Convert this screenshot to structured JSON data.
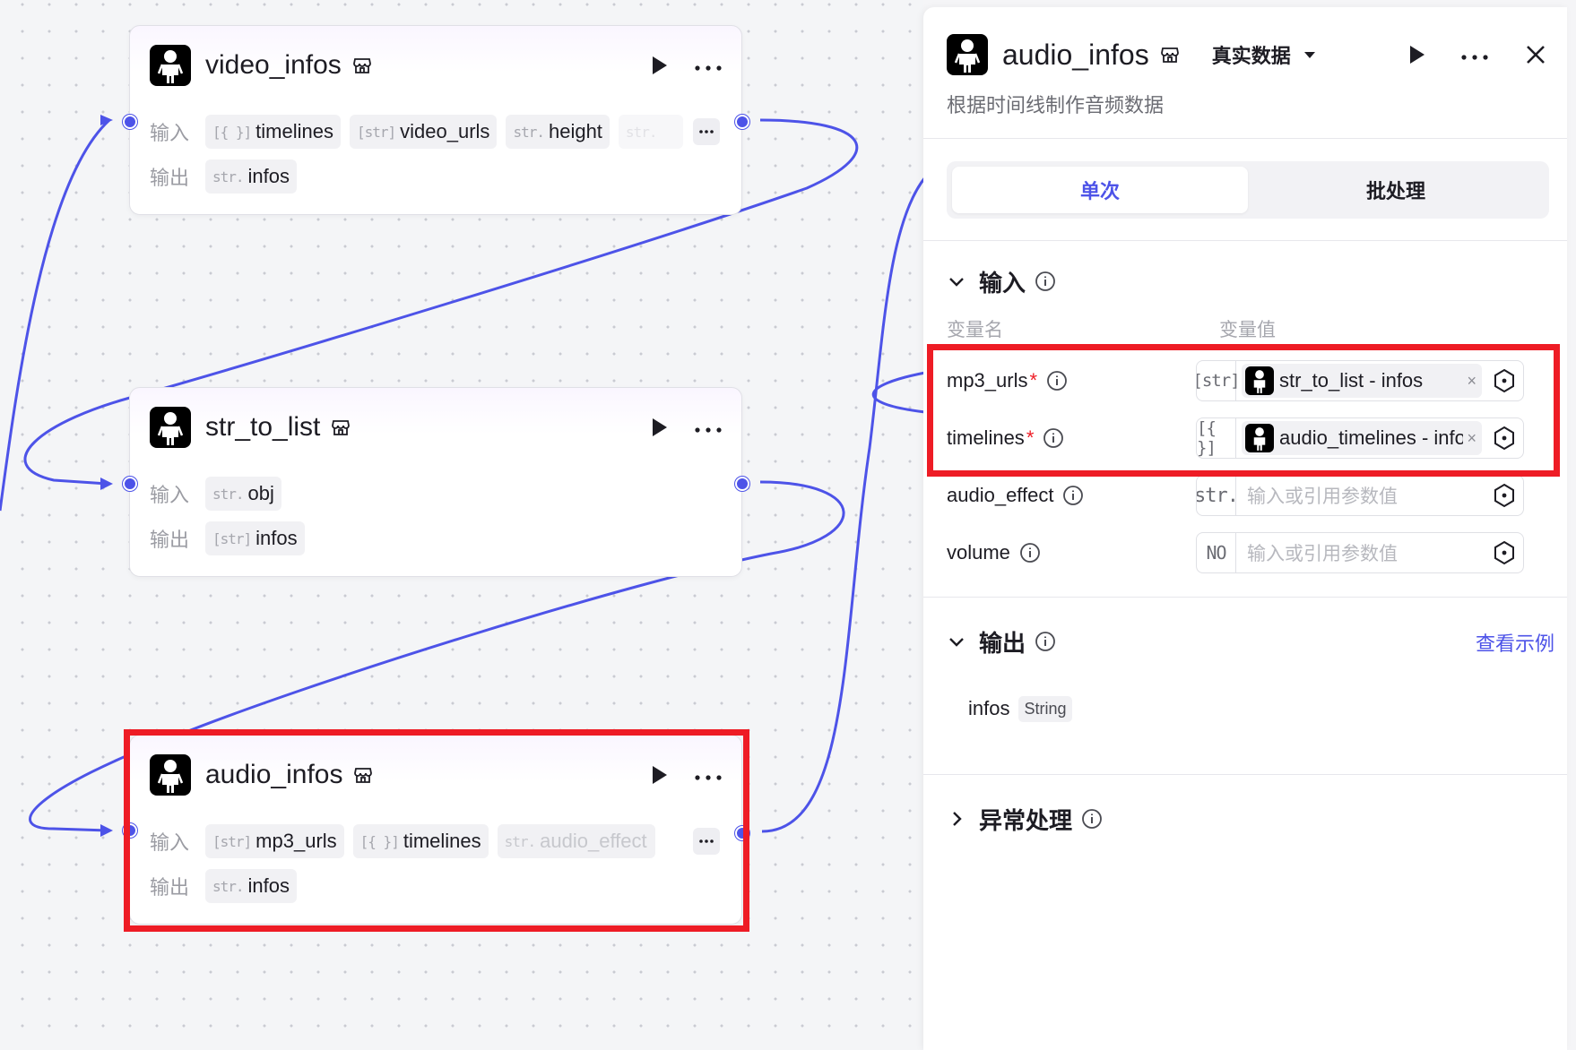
{
  "nodes": {
    "video_infos": {
      "title": "video_infos",
      "input_label": "输入",
      "output_label": "输出",
      "inputs": [
        {
          "type": "[{ }]",
          "name": "timelines"
        },
        {
          "type": "[str]",
          "name": "video_urls"
        },
        {
          "type": "str.",
          "name": "height"
        },
        {
          "type": "str.",
          "name": ""
        }
      ],
      "outputs": [
        {
          "type": "str.",
          "name": "infos"
        }
      ]
    },
    "str_to_list": {
      "title": "str_to_list",
      "input_label": "输入",
      "output_label": "输出",
      "inputs": [
        {
          "type": "str.",
          "name": "obj"
        }
      ],
      "outputs": [
        {
          "type": "[str]",
          "name": "infos"
        }
      ]
    },
    "audio_infos": {
      "title": "audio_infos",
      "input_label": "输入",
      "output_label": "输出",
      "inputs": [
        {
          "type": "[str]",
          "name": "mp3_urls"
        },
        {
          "type": "[{ }]",
          "name": "timelines"
        },
        {
          "type": "str.",
          "name": "audio_effect"
        }
      ],
      "outputs": [
        {
          "type": "str.",
          "name": "infos"
        }
      ]
    }
  },
  "panel": {
    "title": "audio_infos",
    "data_mode": "真实数据",
    "description": "根据时间线制作音频数据",
    "tabs": [
      "单次",
      "批处理"
    ],
    "input_section": "输入",
    "col_name": "变量名",
    "col_value": "变量值",
    "params": [
      {
        "name": "mp3_urls",
        "required": "*",
        "type": "[str]",
        "ref": "str_to_list - infos",
        "clear": "×"
      },
      {
        "name": "timelines",
        "required": "*",
        "type": "[{ }]",
        "ref": "audio_timelines - infos",
        "clear": "×"
      },
      {
        "name": "audio_effect",
        "required": "",
        "type": "str.",
        "placeholder": "输入或引用参数值"
      },
      {
        "name": "volume",
        "required": "",
        "type": "NO",
        "placeholder": "输入或引用参数值"
      }
    ],
    "output_section": "输出",
    "view_example": "查看示例",
    "output": {
      "name": "infos",
      "type": "String"
    },
    "error_section": "异常处理"
  },
  "colors": {
    "accent": "#4d53e8",
    "highlight": "#ee1c25",
    "link": "#4d53e8"
  }
}
